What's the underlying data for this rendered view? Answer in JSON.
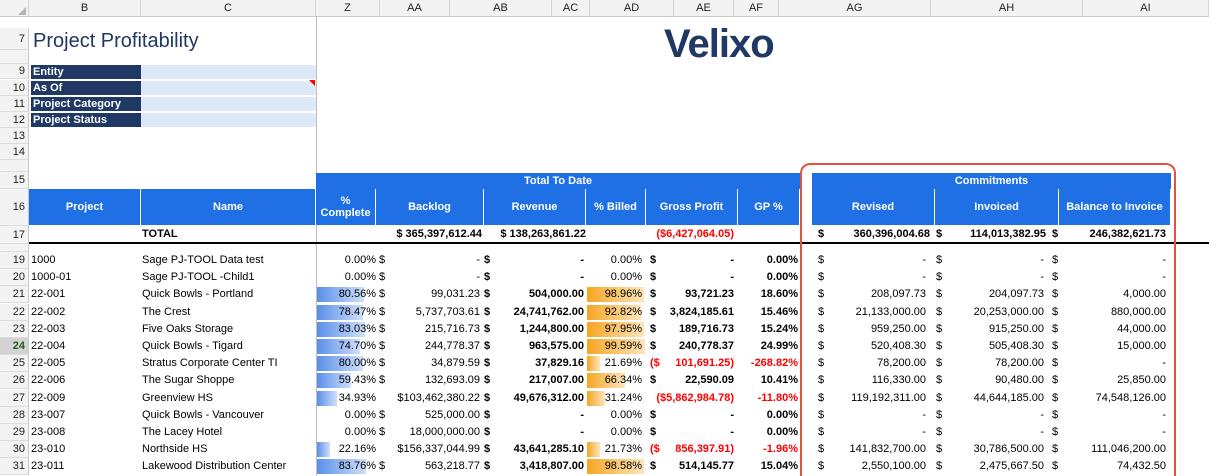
{
  "columns": [
    "B",
    "C",
    "Z",
    "AA",
    "AB",
    "AC",
    "AD",
    "AE",
    "AF",
    "AG",
    "AH",
    "AI"
  ],
  "title": "Project Profitability",
  "logo": "Velixo",
  "filters": [
    "Entity",
    "As Of",
    "Project Category",
    "Project Status"
  ],
  "rows_top": [
    "7",
    "9",
    "10",
    "11",
    "12",
    "13",
    "14",
    "15",
    "16",
    "17"
  ],
  "band_total": "Total To Date",
  "band_commit": "Commitments",
  "headers": {
    "project": "Project",
    "name": "Name",
    "complete": "% Complete",
    "backlog": "Backlog",
    "revenue": "Revenue",
    "billed": "% Billed",
    "gross": "Gross Profit",
    "gp": "GP %",
    "revised": "Revised",
    "invoiced": "Invoiced",
    "balance": "Balance to Invoice"
  },
  "total": {
    "label": "TOTAL",
    "backlog": "$ 365,397,612.44",
    "revenue": "$ 138,263,861.22",
    "gross": "($6,427,064.05)",
    "revised_sym": "$",
    "revised": "360,396,004.68",
    "invoiced_sym": "$",
    "invoiced": "114,013,382.95",
    "balance_sym": "$",
    "balance": "246,382,621.73"
  },
  "rows": [
    {
      "rn": "19",
      "project": "1000",
      "name": "Sage PJ-TOOL Data test",
      "complete": "0.00%",
      "complete_pct": 0,
      "backlog": "-",
      "revenue": "-",
      "billed": "0.00%",
      "billed_pct": 0,
      "gross": "-",
      "gp": "0.00%",
      "revised": "-",
      "invoiced": "-",
      "balance": "-",
      "neg": false
    },
    {
      "rn": "20",
      "project": "1000-01",
      "name": "Sage PJ-TOOL -Child1",
      "complete": "0.00%",
      "complete_pct": 0,
      "backlog": "-",
      "revenue": "-",
      "billed": "0.00%",
      "billed_pct": 0,
      "gross": "-",
      "gp": "0.00%",
      "revised": "-",
      "invoiced": "-",
      "balance": "-",
      "neg": false
    },
    {
      "rn": "21",
      "project": "22-001",
      "name": "Quick Bowls - Portland",
      "complete": "80.56%",
      "complete_pct": 80.56,
      "backlog": "99,031.23",
      "revenue": "504,000.00",
      "billed": "98.96%",
      "billed_pct": 98.96,
      "gross": "93,721.23",
      "gp": "18.60%",
      "revised": "208,097.73",
      "invoiced": "204,097.73",
      "balance": "4,000.00",
      "neg": false
    },
    {
      "rn": "22",
      "project": "22-002",
      "name": "The Crest",
      "complete": "78.47%",
      "complete_pct": 78.47,
      "backlog": "5,737,703.61",
      "revenue": "24,741,762.00",
      "billed": "92.82%",
      "billed_pct": 92.82,
      "gross": "3,824,185.61",
      "gp": "15.46%",
      "revised": "21,133,000.00",
      "invoiced": "20,253,000.00",
      "balance": "880,000.00",
      "neg": false
    },
    {
      "rn": "23",
      "project": "22-003",
      "name": "Five Oaks Storage",
      "complete": "83.03%",
      "complete_pct": 83.03,
      "backlog": "215,716.73",
      "revenue": "1,244,800.00",
      "billed": "97.95%",
      "billed_pct": 97.95,
      "gross": "189,716.73",
      "gp": "15.24%",
      "revised": "959,250.00",
      "invoiced": "915,250.00",
      "balance": "44,000.00",
      "neg": false
    },
    {
      "rn": "24",
      "project": "22-004",
      "name": "Quick Bowls - Tigard",
      "complete": "74.70%",
      "complete_pct": 74.7,
      "backlog": "244,778.37",
      "revenue": "963,575.00",
      "billed": "99.59%",
      "billed_pct": 99.59,
      "gross": "240,778.37",
      "gp": "24.99%",
      "revised": "520,408.30",
      "invoiced": "505,408.30",
      "balance": "15,000.00",
      "neg": false
    },
    {
      "rn": "25",
      "project": "22-005",
      "name": "Stratus Corporate Center TI",
      "complete": "80.00%",
      "complete_pct": 80,
      "backlog": "34,879.59",
      "revenue": "37,829.16",
      "billed": "21.69%",
      "billed_pct": 21.69,
      "gross": "101,691.25",
      "gp": "-268.82%",
      "revised": "78,200.00",
      "invoiced": "78,200.00",
      "balance": "-",
      "neg": true
    },
    {
      "rn": "26",
      "project": "22-006",
      "name": "The Sugar Shoppe",
      "complete": "59.43%",
      "complete_pct": 59.43,
      "backlog": "132,693.09",
      "revenue": "217,007.00",
      "billed": "66.34%",
      "billed_pct": 66.34,
      "gross": "22,590.09",
      "gp": "10.41%",
      "revised": "116,330.00",
      "invoiced": "90,480.00",
      "balance": "25,850.00",
      "neg": false
    },
    {
      "rn": "27",
      "project": "22-009",
      "name": "Greenview HS",
      "complete": "34.93%",
      "complete_pct": 34.93,
      "backlog": "$103,462,380.22",
      "revenue": "49,676,312.00",
      "billed": "31.24%",
      "billed_pct": 31.24,
      "gross": "($5,862,984.78)",
      "gp": "-11.80%",
      "revised": "119,192,311.00",
      "invoiced": "44,644,185.00",
      "balance": "74,548,126.00",
      "neg": true
    },
    {
      "rn": "28",
      "project": "23-007",
      "name": "Quick Bowls - Vancouver",
      "complete": "0.00%",
      "complete_pct": 0,
      "backlog": "525,000.00",
      "revenue": "-",
      "billed": "0.00%",
      "billed_pct": 0,
      "gross": "-",
      "gp": "0.00%",
      "revised": "-",
      "invoiced": "-",
      "balance": "-",
      "neg": false
    },
    {
      "rn": "29",
      "project": "23-008",
      "name": "The Lacey Hotel",
      "complete": "0.00%",
      "complete_pct": 0,
      "backlog": "18,000,000.00",
      "revenue": "-",
      "billed": "0.00%",
      "billed_pct": 0,
      "gross": "-",
      "gp": "0.00%",
      "revised": "-",
      "invoiced": "-",
      "balance": "-",
      "neg": false
    },
    {
      "rn": "30",
      "project": "23-010",
      "name": "Northside HS",
      "complete": "22.16%",
      "complete_pct": 22.16,
      "backlog": "$156,337,044.99",
      "revenue": "43,641,285.10",
      "billed": "21.73%",
      "billed_pct": 21.73,
      "gross": "856,397.91",
      "gp": "-1.96%",
      "revised": "141,832,700.00",
      "invoiced": "30,786,500.00",
      "balance": "111,046,200.00",
      "neg": true
    },
    {
      "rn": "31",
      "project": "23-011",
      "name": "Lakewood Distribution Center",
      "complete": "83.76%",
      "complete_pct": 83.76,
      "backlog": "563,218.77",
      "revenue": "3,418,807.00",
      "billed": "98.58%",
      "billed_pct": 98.58,
      "gross": "514,145.77",
      "gp": "15.04%",
      "revised": "2,550,100.00",
      "invoiced": "2,475,667.50",
      "balance": "74,432.50",
      "neg": false
    }
  ],
  "colors": {
    "navy": "#203864",
    "header_blue": "#1f6fe5",
    "highlight": "#e0533d",
    "negative": "#ff0000"
  }
}
